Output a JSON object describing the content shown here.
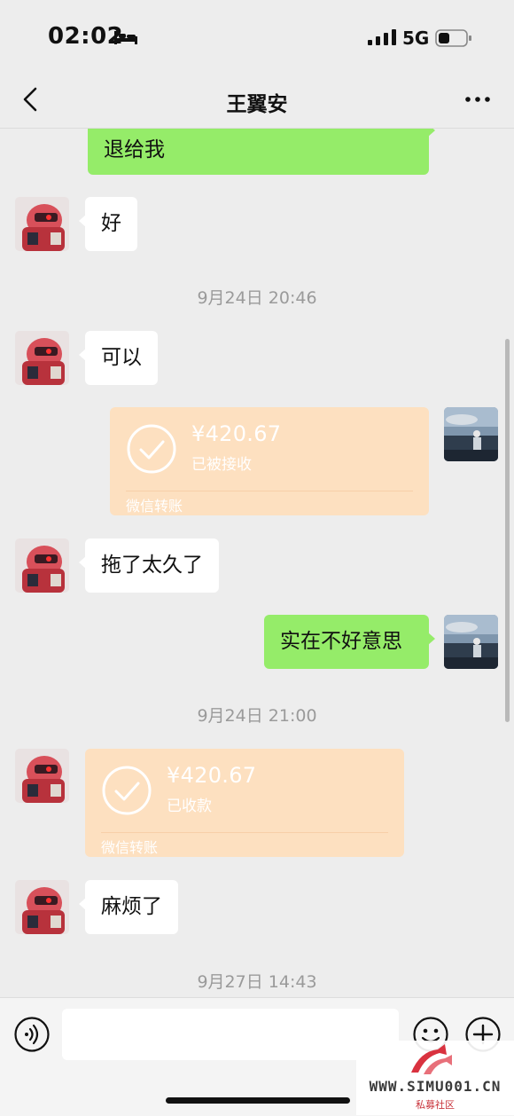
{
  "status_bar": {
    "time": "02:02",
    "network": "5G"
  },
  "header": {
    "title": "王翼安"
  },
  "messages": {
    "m0": "退给我",
    "m1": "好",
    "t1": "9月24日 20:46",
    "m2": "可以",
    "tr1": {
      "amount": "¥420.67",
      "status": "已被接收",
      "footer": "微信转账"
    },
    "m3": "拖了太久了",
    "m4": "实在不好意思",
    "t2": "9月24日 21:00",
    "tr2": {
      "amount": "¥420.67",
      "status": "已收款",
      "footer": "微信转账"
    },
    "m5": "麻烦了",
    "t3": "9月27日 14:43"
  },
  "input": {
    "value": "",
    "placeholder": ""
  },
  "watermark": {
    "site": "WWW.SIMU001.CN",
    "sub": "私募社区"
  },
  "colors": {
    "background": "#ededed",
    "bubble_self": "#95ec69",
    "bubble_other": "#ffffff",
    "transfer_card": "#fde0c0",
    "timestamp": "#9a9a9a"
  },
  "icons": [
    "back-icon",
    "more-icon",
    "bed-icon",
    "signal-icon",
    "battery-icon",
    "voice-icon",
    "emoji-icon",
    "plus-icon",
    "check-circle-icon"
  ]
}
